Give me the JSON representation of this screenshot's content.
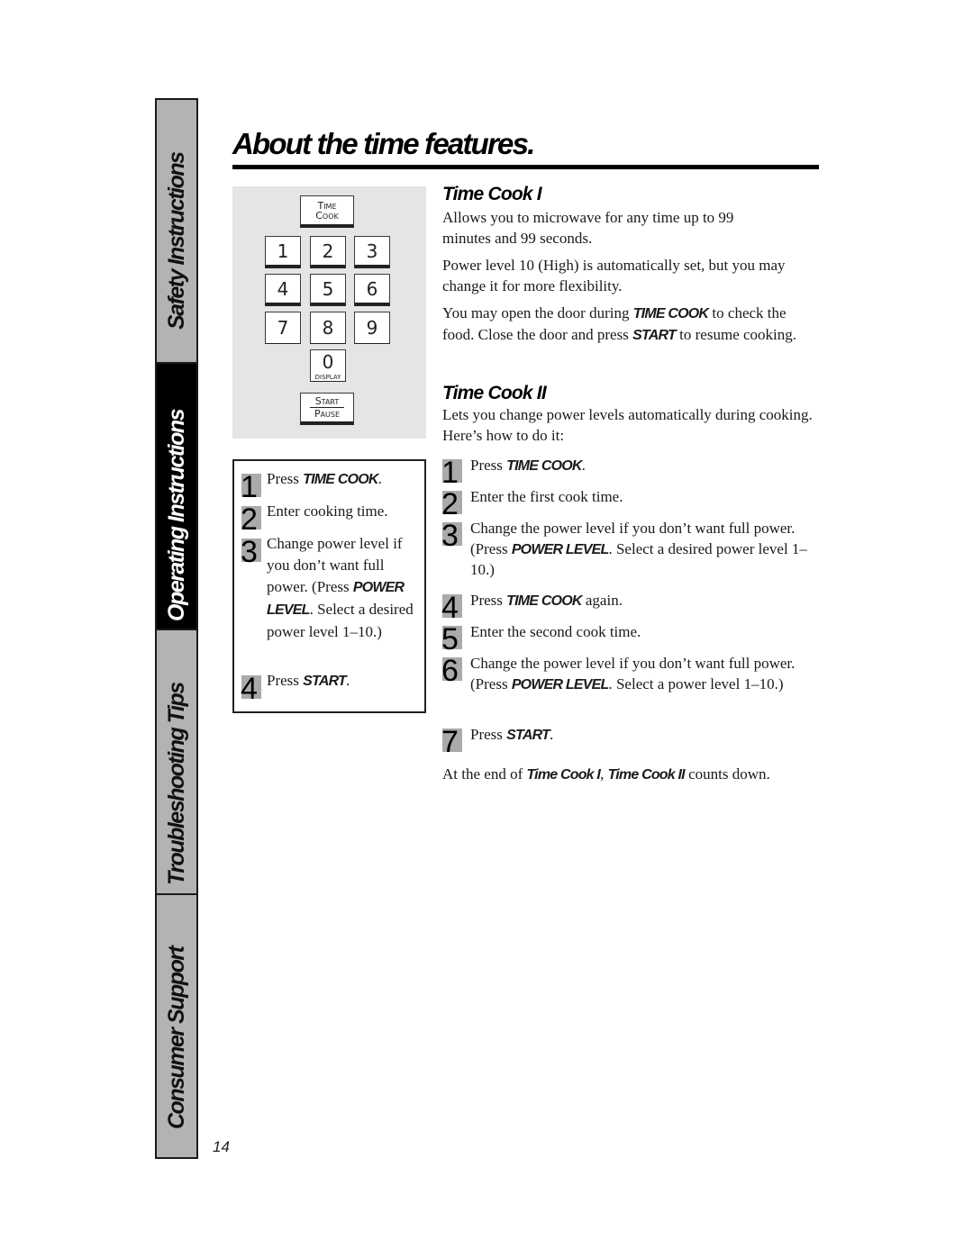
{
  "side_tabs": [
    {
      "label": "Safety Instructions",
      "active": false
    },
    {
      "label": "Operating Instructions",
      "active": true
    },
    {
      "label": "Troubleshooting Tips",
      "active": false
    },
    {
      "label": "Consumer Support",
      "active": false
    }
  ],
  "page_number": "14",
  "title": "About the time features.",
  "keypad": {
    "time_cook": [
      "Time",
      "Cook"
    ],
    "digits": [
      "1",
      "2",
      "3",
      "4",
      "5",
      "6",
      "7",
      "8",
      "9"
    ],
    "zero": "0",
    "zero_sub": "DISPLAY",
    "start_pause": [
      "Start",
      "Pause"
    ]
  },
  "left_steps": [
    {
      "num": "1",
      "pre": "Press ",
      "kw": "TIME COOK",
      "post": "."
    },
    {
      "num": "2",
      "pre": "Enter cooking time.",
      "kw": "",
      "post": ""
    },
    {
      "num": "3",
      "pre": "Change power level if you don’t want full power. (Press ",
      "kw": "POWER LEVEL",
      "post": ". Select a desired power level 1–10.)"
    },
    {
      "num": "4",
      "pre": "Press ",
      "kw": "START",
      "post": "."
    }
  ],
  "time_cook_1": {
    "heading": "Time Cook I",
    "p1": "Allows you to microwave for any time up to 99 minutes and 99 seconds.",
    "p2": "Power level 10 (High) is automatically set, but you may change it for more flexibility.",
    "p3": {
      "a": "You may open the door during ",
      "kw1": "TIME COOK",
      "b": " to check the food. Close the door and press ",
      "kw2": "START",
      "c": " to resume cooking."
    }
  },
  "time_cook_2": {
    "heading": "Time Cook II",
    "intro": "Lets you change power levels automatically during cooking. Here’s how to do it:",
    "steps": [
      {
        "num": "1",
        "pre": "Press ",
        "kw": "TIME COOK",
        "post": "."
      },
      {
        "num": "2",
        "pre": "Enter the first cook time.",
        "kw": "",
        "post": ""
      },
      {
        "num": "3",
        "pre": "Change the power level if you don’t want full power. (Press ",
        "kw": "POWER LEVEL",
        "post": ". Select a desired power level 1–10.)"
      },
      {
        "num": "4",
        "pre": "Press ",
        "kw": "TIME COOK",
        "post": " again."
      },
      {
        "num": "5",
        "pre": "Enter the second cook time.",
        "kw": "",
        "post": ""
      },
      {
        "num": "6",
        "pre": "Change the power level if you don’t want full power. (Press ",
        "kw": "POWER LEVEL",
        "post": ". Select a power level 1–10.)"
      },
      {
        "num": "7",
        "pre": "Press ",
        "kw": "START",
        "post": "."
      }
    ],
    "footer": {
      "a": "At the end of ",
      "kw1": "Time Cook I",
      "b": ", ",
      "kw2": "Time Cook II",
      "c": " counts down."
    }
  }
}
